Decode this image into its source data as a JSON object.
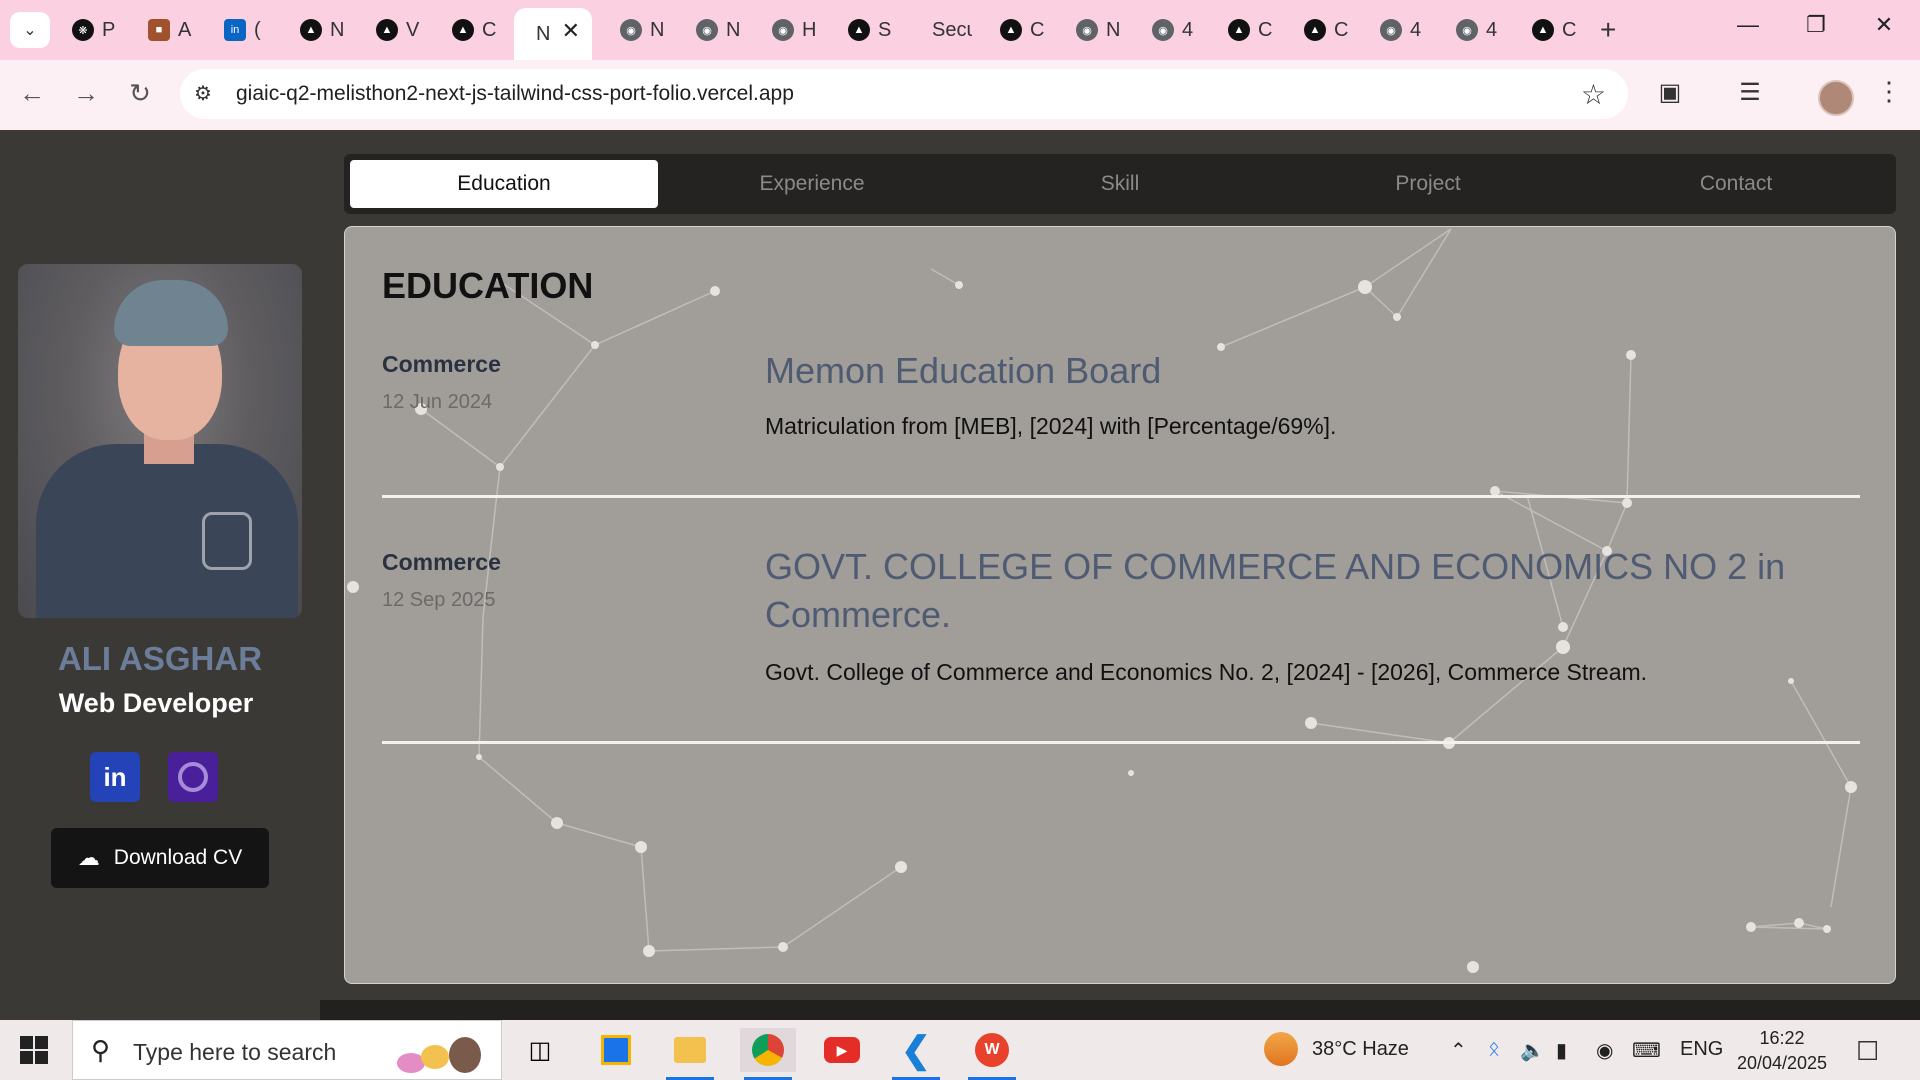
{
  "browser": {
    "tabs": [
      {
        "label": "P",
        "icon": "openai-icon",
        "active": false
      },
      {
        "label": "A",
        "icon": "briefcase-icon",
        "active": false
      },
      {
        "label": "(",
        "icon": "linkedin-icon",
        "active": false
      },
      {
        "label": "N",
        "icon": "avatar-icon",
        "active": false
      },
      {
        "label": "V",
        "icon": "avatar-icon",
        "active": false
      },
      {
        "label": "C",
        "icon": "avatar-icon",
        "active": false
      },
      {
        "label": "N",
        "icon": "",
        "active": true
      },
      {
        "label": "N",
        "icon": "globe-icon",
        "active": false
      },
      {
        "label": "N",
        "icon": "globe-icon",
        "active": false
      },
      {
        "label": "H",
        "icon": "globe-icon",
        "active": false
      },
      {
        "label": "S",
        "icon": "avatar-icon",
        "active": false
      },
      {
        "label": "Secu",
        "icon": "",
        "active": false
      },
      {
        "label": "C",
        "icon": "avatar-icon",
        "active": false
      },
      {
        "label": "N",
        "icon": "globe-icon",
        "active": false
      },
      {
        "label": "4",
        "icon": "globe-icon",
        "active": false
      },
      {
        "label": "C",
        "icon": "avatar-icon",
        "active": false
      },
      {
        "label": "C",
        "icon": "avatar-icon",
        "active": false
      },
      {
        "label": "4",
        "icon": "globe-icon",
        "active": false
      },
      {
        "label": "4",
        "icon": "globe-icon",
        "active": false
      },
      {
        "label": "C",
        "icon": "avatar-icon",
        "active": false
      }
    ],
    "url": "giaic-q2-melisthon2-next-js-tailwind-css-port-folio.vercel.app"
  },
  "sidebar": {
    "name": "ALI ASGHAR",
    "role": "Web Developer",
    "linkedin_label": "in",
    "download_label": "Download CV"
  },
  "nav": {
    "tabs": [
      "Education",
      "Experience",
      "Skill",
      "Project",
      "Contact"
    ],
    "active": "Education"
  },
  "education": {
    "heading": "EDUCATION",
    "entries": [
      {
        "field": "Commerce",
        "date": "12 Jun 2024",
        "title": "Memon Education Board",
        "description": "Matriculation from [MEB], [2024] with [Percentage/69%]."
      },
      {
        "field": "Commerce",
        "date": "12 Sep 2025",
        "title": "GOVT. COLLEGE OF COMMERCE AND ECONOMICS NO 2 in Commerce.",
        "description": "Govt. College of Commerce and Economics No. 2, [2024] - [2026], Commerce Stream."
      }
    ]
  },
  "taskbar": {
    "search_placeholder": "Type here to search",
    "weather": "38°C  Haze",
    "language": "ENG",
    "time": "16:22",
    "date": "20/04/2025"
  },
  "colors": {
    "tabstrip": "#fbd0e0",
    "card": "#a19d98",
    "page": "#3b3936",
    "title": "#4e5b72",
    "name": "#6b7d98"
  }
}
